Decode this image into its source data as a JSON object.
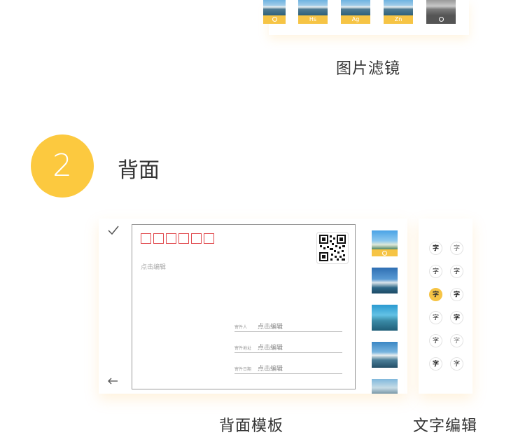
{
  "filters": {
    "thumbs": [
      {
        "label": ""
      },
      {
        "label": "Hs"
      },
      {
        "label": "Ag"
      },
      {
        "label": "Zn"
      },
      {
        "label": ""
      }
    ],
    "caption": "图片滤镜"
  },
  "section2": {
    "number": "2",
    "title": "背面"
  },
  "back_panel": {
    "edit_hint": "点击编辑",
    "sender_rows": [
      {
        "label": "寄件人",
        "value": "点击编辑"
      },
      {
        "label": "寄件地址",
        "value": "点击编辑"
      },
      {
        "label": "寄件日期",
        "value": "点击编辑"
      }
    ],
    "caption": "背面模板"
  },
  "text_panel": {
    "glyph": "字",
    "caption": "文字编辑"
  },
  "colors": {
    "accent": "#fcc93f",
    "zip_red": "#e0464a"
  }
}
